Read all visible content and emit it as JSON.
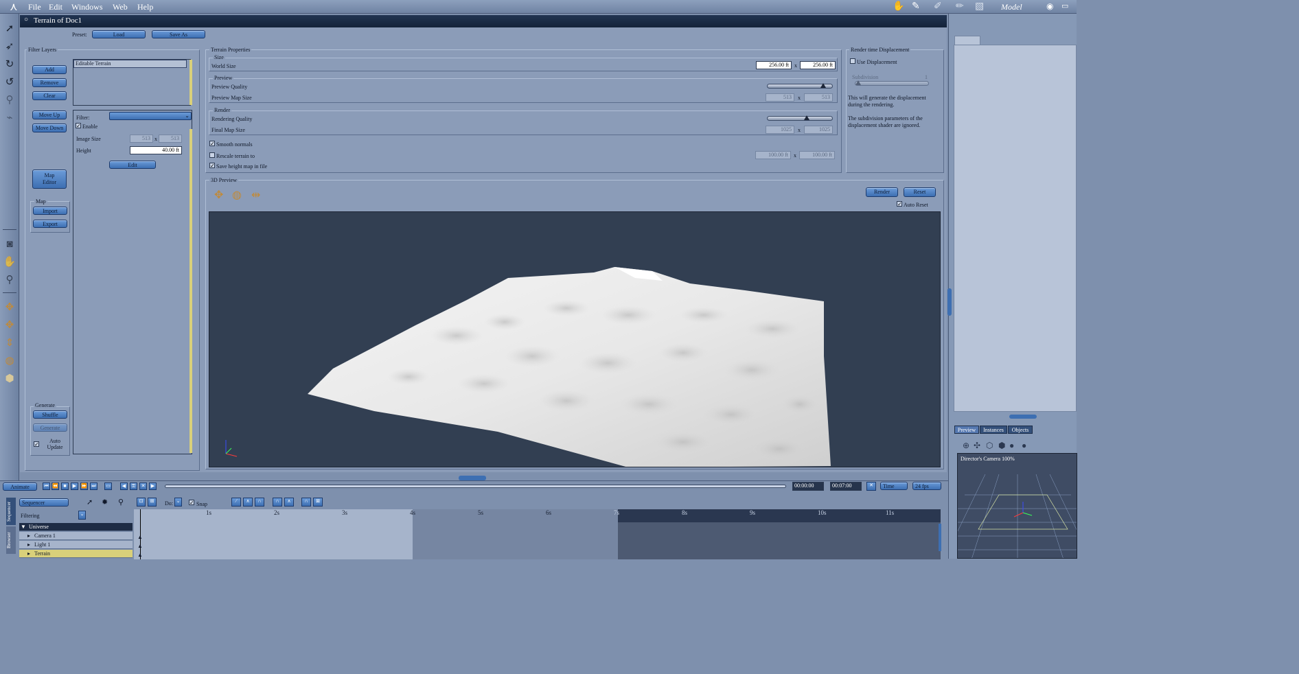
{
  "menubar": {
    "items": [
      "File",
      "Edit",
      "Windows",
      "Web",
      "Help"
    ],
    "mode": "Model"
  },
  "window": {
    "title": "Terrain of Doc1"
  },
  "preset": {
    "label": "Preset:",
    "load": "Load",
    "save_as": "Save As"
  },
  "filter_layers": {
    "title": "Filter Layers",
    "buttons": {
      "add": "Add",
      "remove": "Remove",
      "clear": "Clear",
      "move_up": "Move Up",
      "move_down": "Move Down",
      "map_editor": "Map Editor"
    },
    "layer_item": "Editable Terrain",
    "filter_label": "Filter:",
    "enable_label": "Enable",
    "image_size_label": "Image Size",
    "image_w": "513",
    "image_h": "513",
    "height_label": "Height",
    "height_value": "40.00 ft",
    "edit": "Edit",
    "map_title": "Map",
    "import": "Import",
    "export": "Export",
    "generate_title": "Generate",
    "shuffle": "Shuffle",
    "generate": "Generate",
    "auto_update": "Auto Update",
    "x": "x"
  },
  "terrain_properties": {
    "title": "Terrain Properties",
    "size_title": "Size",
    "world_size_label": "World Size",
    "world_w": "256.00 ft",
    "world_h": "256.00 ft",
    "preview_title": "Preview",
    "preview_quality_label": "Preview Quality",
    "preview_map_size_label": "Preview Map Size",
    "preview_w": "513",
    "preview_h": "513",
    "render_title": "Render",
    "rendering_quality_label": "Rendering Quality",
    "final_map_size_label": "Final Map Size",
    "final_w": "1025",
    "final_h": "1025",
    "smooth_normals": "Smooth normals",
    "rescale_terrain": "Rescale terrain to",
    "rescale_w": "100.00 ft",
    "rescale_h": "100.00 ft",
    "save_height_map": "Save height map in file",
    "preview_quality_level": 0.88,
    "rendering_quality_level": 0.6
  },
  "displacement": {
    "title": "Render time Displacement",
    "use_displacement": "Use Displacement",
    "subdivision_label": "Subdivision",
    "subdivision_value": "1",
    "note1": "This will generate the displacement during the rendering.",
    "note2": "The subdivision parameters of the displacement shader are ignored."
  },
  "preview3d": {
    "title": "3D Preview",
    "render": "Render",
    "reset": "Reset",
    "auto_reset": "Auto Reset"
  },
  "timeline": {
    "animate": "Animate",
    "time_start": "00:00:00",
    "time_end": "00:07:00",
    "time_mode": "Time",
    "fps": "24 fps",
    "sequencer": "Sequencer",
    "filtering": "Filtering",
    "do_label": "Do:",
    "snap": "Snap",
    "ticks": [
      "1s",
      "2s",
      "3s",
      "4s",
      "5s",
      "6s",
      "7s",
      "8s",
      "9s",
      "10s",
      "11s"
    ],
    "tracks": [
      "Universe",
      "Camera 1",
      "Light 1",
      "Terrain"
    ],
    "side_tabs": [
      "Sequencer",
      "Browser"
    ]
  },
  "right_panel": {
    "tabs": [
      "Preview",
      "Instances",
      "Objects"
    ],
    "camera_label": "Director's Camera 100%"
  },
  "colors": {
    "accent": "#3d6fb2",
    "selection": "#d9d07a"
  }
}
